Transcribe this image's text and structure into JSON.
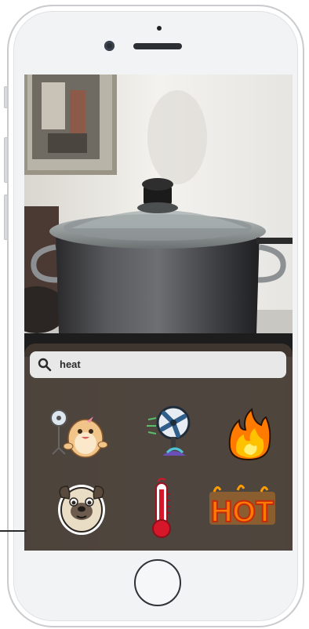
{
  "device": "iPhone",
  "stickers_panel": {
    "search": {
      "query": "heat",
      "icon": "magnifier-icon"
    },
    "stickers": [
      {
        "name": "hamster-with-fan-sticker"
      },
      {
        "name": "electric-fan-sticker"
      },
      {
        "name": "fire-sticker"
      },
      {
        "name": "pug-dog-sticker"
      },
      {
        "name": "thermometer-sticker"
      },
      {
        "name": "hot-text-sticker",
        "text": "HOT"
      }
    ]
  },
  "colors": {
    "panel": "#42382f",
    "search_bg": "#e8e8e8",
    "fire": "#ff9d00",
    "thermometer_red": "#d6172a"
  }
}
